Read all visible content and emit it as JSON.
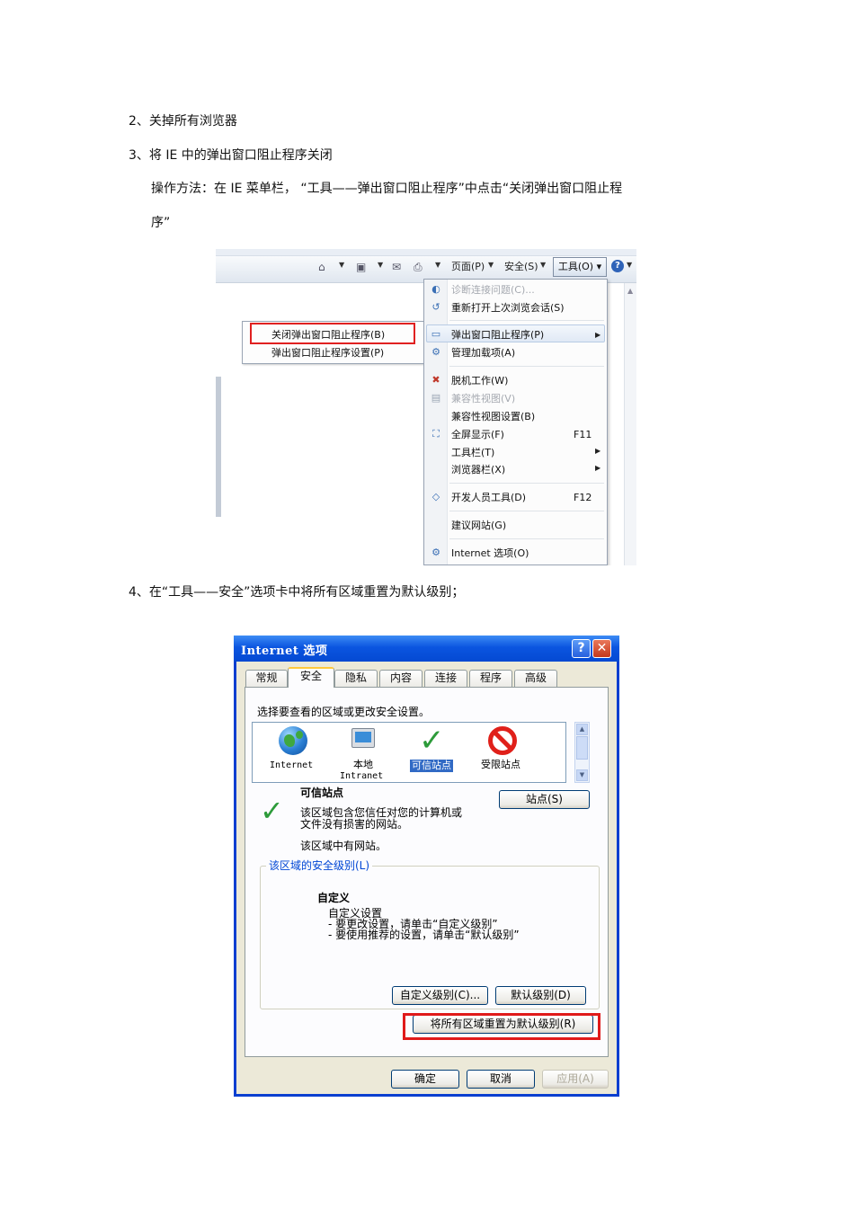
{
  "steps": {
    "step2": "2、关掉所有浏览器",
    "step3": "3、将  IE  中的弹出窗口阻止程序关闭",
    "step3_method_line1": "操作方法：在    IE  菜单栏，  “工具——弹出窗口阻止程序”中点击“关闭弹出窗口阻止程",
    "step3_method_line2": "序”",
    "step4": "4、在“工具——安全”选项卡中将所有区域重置为默认级别；"
  },
  "ie_toolbar": {
    "page": "页面(P)",
    "safety": "安全(S)",
    "tools": "工具(O)",
    "help": "?"
  },
  "popup_submenu": {
    "items": [
      "关闭弹出窗口阻止程序(B)",
      "弹出窗口阻止程序设置(P)"
    ]
  },
  "tools_menu": {
    "items": [
      {
        "label": "诊断连接问题(C)...",
        "disabled": true
      },
      {
        "label": "重新打开上次浏览会话(S)"
      },
      {
        "label": "弹出窗口阻止程序(P)",
        "submenu": true
      },
      {
        "label": "管理加载项(A)"
      },
      {
        "label": "脱机工作(W)"
      },
      {
        "label": "兼容性视图(V)",
        "disabled": true
      },
      {
        "label": "兼容性视图设置(B)"
      },
      {
        "label": "全屏显示(F)",
        "shortcut": "F11"
      },
      {
        "label": "工具栏(T)",
        "submenu": true
      },
      {
        "label": "浏览器栏(X)",
        "submenu": true
      },
      {
        "label": "开发人员工具(D)",
        "shortcut": "F12"
      },
      {
        "label": "建议网站(G)"
      },
      {
        "label": "Internet 选项(O)"
      }
    ]
  },
  "dialog": {
    "title": "Internet 选项",
    "title_help": "?",
    "title_close": "✕",
    "tabs": [
      "常规",
      "安全",
      "隐私",
      "内容",
      "连接",
      "程序",
      "高级"
    ],
    "zone_prompt": "选择要查看的区域或更改安全设置。",
    "zones": [
      {
        "name": "Internet"
      },
      {
        "name": "本地",
        "name2": "Intranet"
      },
      {
        "name": "可信站点",
        "selected": true
      },
      {
        "name": "受限站点"
      }
    ],
    "zone_title": "可信站点",
    "zone_desc_line1": "该区域包含您信任对您的计算机或",
    "zone_desc_line2": "文件没有损害的网站。",
    "zone_sites_note": "该区域中有网站。",
    "sites_button": "站点(S)",
    "security_level_legend": "该区域的安全级别(L)",
    "level_name": "自定义",
    "level_desc1": "自定义设置",
    "level_desc2": "- 要更改设置，请单击“自定义级别”",
    "level_desc3": "- 要使用推荐的设置，请单击“默认级别”",
    "custom_level_button": "自定义级别(C)...",
    "default_level_button": "默认级别(D)",
    "reset_all_button": "将所有区域重置为默认级别(R)",
    "ok_button": "确定",
    "cancel_button": "取消",
    "apply_button": "应用(A)"
  },
  "colors": {
    "highlight_box": "#e02020",
    "xp_title_blue": "#0b55e0",
    "selection_blue": "#316ac5",
    "check_green": "#2d9b3a"
  }
}
